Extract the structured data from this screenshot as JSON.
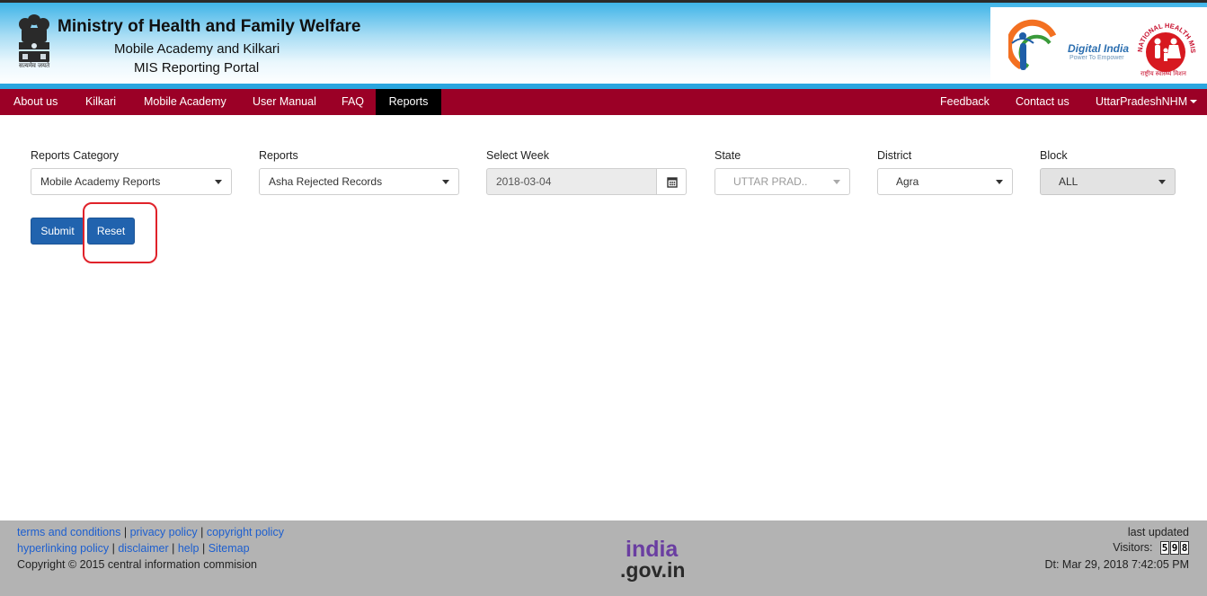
{
  "header": {
    "title": "Ministry of Health and Family Welfare",
    "subtitle1": "Mobile Academy and Kilkari",
    "subtitle2": "MIS Reporting Portal",
    "emblem_caption": "सत्यमेव जयते",
    "digital_india": "Digital India",
    "digital_india_tagline": "Power To Empower",
    "nhm_arc_text": "NATIONAL HEALTH MISSION",
    "nhm_caption": "राष्ट्रीय स्वास्थ्य मिशन"
  },
  "nav": {
    "left": [
      {
        "label": "About us"
      },
      {
        "label": "Kilkari"
      },
      {
        "label": "Mobile Academy"
      },
      {
        "label": "User Manual"
      },
      {
        "label": "FAQ"
      },
      {
        "label": "Reports",
        "active": true
      }
    ],
    "right": [
      {
        "label": "Feedback"
      },
      {
        "label": "Contact us"
      },
      {
        "label": "UttarPradeshNHM"
      }
    ]
  },
  "form": {
    "reports_category": {
      "label": "Reports Category",
      "value": "Mobile Academy Reports"
    },
    "reports": {
      "label": "Reports",
      "value": "Asha Rejected Records"
    },
    "week": {
      "label": "Select Week",
      "value": "2018-03-04",
      "icon": "calendar-icon"
    },
    "state": {
      "label": "State",
      "value": "UTTAR PRAD..",
      "disabled": true
    },
    "district": {
      "label": "District",
      "value": "Agra"
    },
    "block": {
      "label": "Block",
      "value": "ALL"
    },
    "submit_label": "Submit",
    "reset_label": "Reset"
  },
  "footer": {
    "links_row1": [
      "terms and conditions",
      "privacy policy",
      "copyright policy"
    ],
    "links_row2": [
      "hyperlinking policy",
      "disclaimer",
      "help",
      "Sitemap"
    ],
    "separator": "|",
    "copyright": "Copyright © 2015 central information commision",
    "logo_top": "india",
    "logo_bottom": ".gov.in",
    "last_updated": "last updated",
    "visitors_label": "Visitors:",
    "visitors_digits": [
      "5",
      "9",
      "8"
    ],
    "datetime": "Dt: Mar 29, 2018 7:42:05 PM"
  },
  "colors": {
    "navbar": "#9b0026",
    "nav_active": "#000000",
    "button": "#2163ae",
    "highlight": "#e0222a",
    "footer": "#b3b3b3",
    "link": "#1d5fcf"
  }
}
